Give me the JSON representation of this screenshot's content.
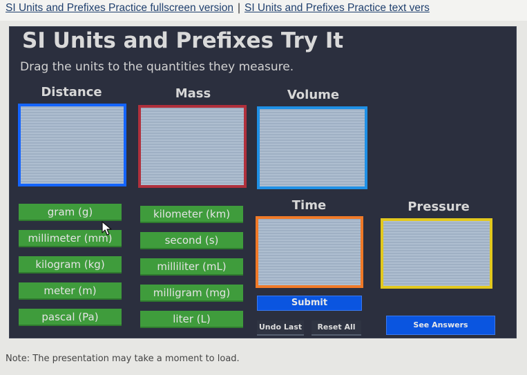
{
  "top_links": {
    "fullscreen": "SI Units and Prefixes Practice fullscreen version",
    "separator": "|",
    "text_version": "SI Units and Prefixes Practice text vers"
  },
  "activity": {
    "title": "SI Units and Prefixes Try It",
    "instruction": "Drag the units to the quantities they measure."
  },
  "categories": {
    "distance": "Distance",
    "mass": "Mass",
    "volume": "Volume",
    "time": "Time",
    "pressure": "Pressure"
  },
  "units": [
    "gram (g)",
    "kilometer (km)",
    "millimeter (mm)",
    "second (s)",
    "kilogram (kg)",
    "milliliter (mL)",
    "meter (m)",
    "milligram (mg)",
    "pascal (Pa)",
    "liter (L)"
  ],
  "buttons": {
    "submit": "Submit",
    "undo_last": "Undo Last",
    "reset_all": "Reset All",
    "see_answers": "See Answers"
  },
  "note": "Note: The presentation may take a moment to load.",
  "icons": {
    "cursor": "arrow-cursor-icon"
  },
  "colors": {
    "stage_bg": "#2b2f3e",
    "unit_green": "#3f9c3c",
    "button_blue": "#0a55e0",
    "distance_border": "#1464ff",
    "mass_border": "#b0303c",
    "volume_border": "#1f90e6",
    "time_border": "#f07a28",
    "pressure_border": "#e2c81e"
  }
}
